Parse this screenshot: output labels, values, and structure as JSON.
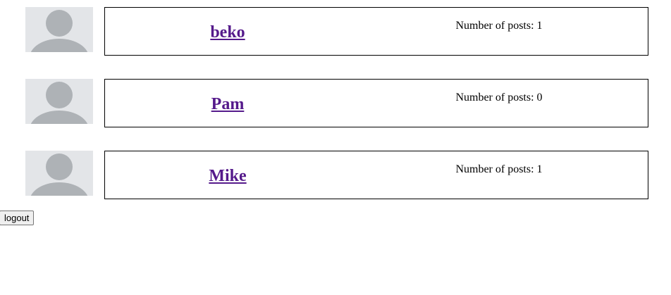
{
  "users": [
    {
      "username": "beko",
      "posts_label": "Number of posts: 1",
      "avatar_icon": "default-user-icon"
    },
    {
      "username": "Pam",
      "posts_label": "Number of posts: 0",
      "avatar_icon": "default-user-icon"
    },
    {
      "username": "Mike",
      "posts_label": "Number of posts: 1",
      "avatar_icon": "default-user-icon"
    }
  ],
  "logout_label": "logout",
  "colors": {
    "link_visited": "#551a8b",
    "avatar_bg": "#e3e5e8",
    "avatar_figure": "#aeb2b6"
  }
}
